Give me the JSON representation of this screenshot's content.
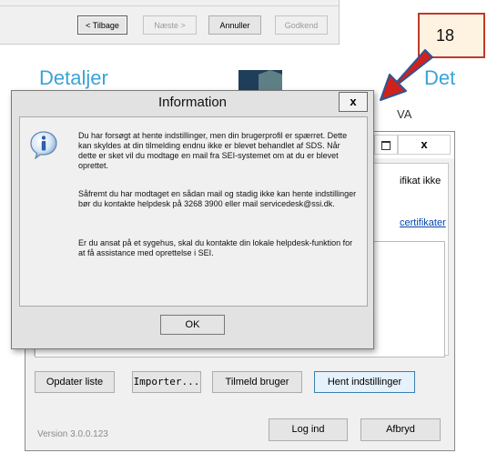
{
  "wizard": {
    "back": "< Tilbage",
    "next": "Næste >",
    "cancel": "Annuller",
    "approve": "Godkend"
  },
  "badge": "18",
  "background": {
    "heading_left": "Detaljer",
    "heading_right": "Det",
    "va_text": "VA"
  },
  "app": {
    "text_fragment": "ifikat ikke",
    "link_fragment": "certifikater",
    "buttons": {
      "update_list": "Opdater liste",
      "import": "Importer...",
      "register_user": "Tilmeld bruger",
      "fetch_settings": "Hent indstillinger",
      "login": "Log ind",
      "cancel": "Afbryd"
    },
    "version": "Version 3.0.0.123",
    "close_glyph": "x"
  },
  "dialog": {
    "title": "Information",
    "close_glyph": "x",
    "para1": "Du har forsøgt at hente indstillinger, men din brugerprofil er spærret. Dette kan skyldes at din tilmelding endnu ikke er blevet behandlet af SDS. Når dette er sket vil du modtage en mail fra SEI-systemet om at du er blevet oprettet.",
    "para2": "Såfremt du har modtaget en sådan mail og stadig ikke kan hente indstillinger bør du kontakte helpdesk på 3268 3900 eller mail servicedesk@ssi.dk.",
    "para3": "Er du ansat på et sygehus, skal du kontakte din lokale helpdesk-funktion for at få assistance med oprettelse i SEI.",
    "ok": "OK"
  },
  "colors": {
    "accent_blue": "#3aa3d8",
    "arrow_red": "#d0211b",
    "arrow_blue": "#2f5597",
    "badge_border": "#c0392b"
  }
}
